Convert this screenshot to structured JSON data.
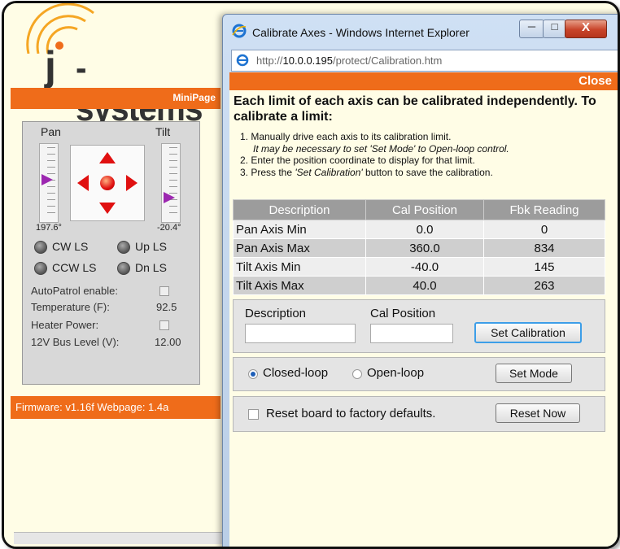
{
  "brand": {
    "logo_text": "-systems",
    "logo_j": "j"
  },
  "bg": {
    "minipage_label": "MiniPage",
    "pan_label": "Pan",
    "tilt_label": "Tilt",
    "pan_value": "197.6°",
    "tilt_value": "-20.4°",
    "pan_fraction": 0.45,
    "tilt_fraction": 0.72,
    "limit_switches": [
      {
        "label": "CW LS"
      },
      {
        "label": "Up LS"
      },
      {
        "label": "CCW LS"
      },
      {
        "label": "Dn LS"
      }
    ],
    "status": [
      {
        "label": "AutoPatrol enable:",
        "value": ""
      },
      {
        "label": "Temperature (F):",
        "value": "92.5"
      },
      {
        "label": "Heater Power:",
        "value": ""
      },
      {
        "label": "12V Bus Level (V):",
        "value": "12.00"
      }
    ],
    "firmware_text": "Firmware: v1.16f  Webpage: 1.4a"
  },
  "window": {
    "title": "Calibrate Axes - Windows Internet Explorer",
    "url_prefix": "http://",
    "url_host": "10.0.0.195",
    "url_path": "/protect/Calibration.htm"
  },
  "popup": {
    "close_label": "Close",
    "intro": "Each limit of each axis can be calibrated independently. To calibrate a limit:",
    "steps": [
      "1.  Manually drive each axis to its calibration limit.",
      "It may be necessary to set 'Set Mode' to Open-loop control.",
      "2.  Enter the position coordinate to display for that limit.",
      "3.  Press the ",
      "'Set Calibration'",
      " button to save the calibration."
    ],
    "table": {
      "headers": [
        "Description",
        "Cal Position",
        "Fbk Reading"
      ],
      "rows": [
        [
          "Pan Axis Min",
          "0.0",
          "0"
        ],
        [
          "Pan Axis Max",
          "360.0",
          "834"
        ],
        [
          "Tilt Axis Min",
          "-40.0",
          "145"
        ],
        [
          "Tilt Axis Max",
          "40.0",
          "263"
        ]
      ]
    },
    "form": {
      "description_label": "Description",
      "cal_position_label": "Cal Position",
      "description_value": "",
      "cal_position_value": "",
      "set_calibration_button": "Set Calibration"
    },
    "mode": {
      "closed_loop_label": "Closed-loop",
      "open_loop_label": "Open-loop",
      "selected": "Closed-loop",
      "set_mode_button": "Set Mode"
    },
    "reset": {
      "label": "Reset board to factory defaults.",
      "button": "Reset Now"
    }
  },
  "colors": {
    "accent": "#ef6c1a",
    "table_header": "#9c9c9c",
    "arrow": "#e01010",
    "thumb": "#9c27b0"
  }
}
